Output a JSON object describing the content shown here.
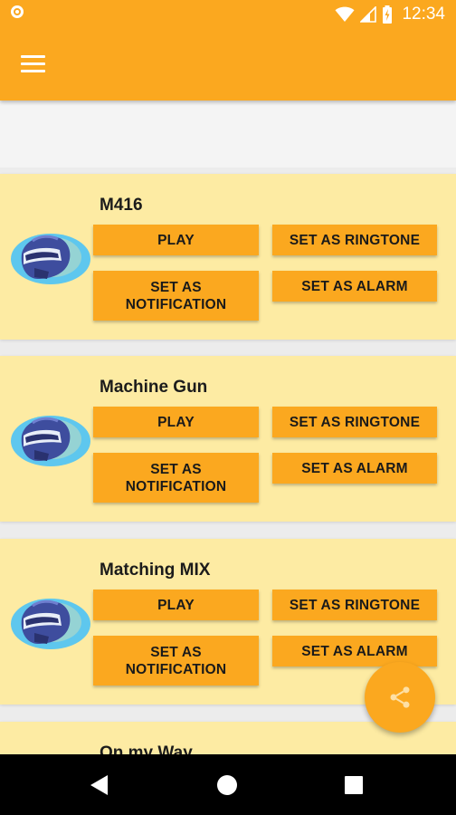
{
  "status_bar": {
    "time": "12:34"
  },
  "colors": {
    "accent": "#fba81f",
    "card_bg": "#fdeba3",
    "helmet_blue": "#3e4d9e",
    "helmet_glow": "#5ec7ee"
  },
  "toolbar": {
    "menu_icon": "menu-icon"
  },
  "cards": [
    {
      "title": "M416",
      "play_label": "PLAY",
      "ringtone_label": "SET AS RINGTONE",
      "notification_label_1": "SET AS",
      "notification_label_2": "NOTIFICATION",
      "alarm_label": "SET AS ALARM"
    },
    {
      "title": "Machine Gun",
      "play_label": "PLAY",
      "ringtone_label": "SET AS RINGTONE",
      "notification_label_1": "SET AS",
      "notification_label_2": "NOTIFICATION",
      "alarm_label": "SET AS ALARM"
    },
    {
      "title": "Matching MIX",
      "play_label": "PLAY",
      "ringtone_label": "SET AS RINGTONE",
      "notification_label_1": "SET AS",
      "notification_label_2": "NOTIFICATION",
      "alarm_label": "SET AS ALARM"
    },
    {
      "title": "On my Way"
    }
  ],
  "fab": {
    "icon": "share-icon"
  },
  "nav_bar": {
    "back_icon": "back-icon",
    "home_icon": "home-icon",
    "recents_icon": "recents-icon"
  }
}
